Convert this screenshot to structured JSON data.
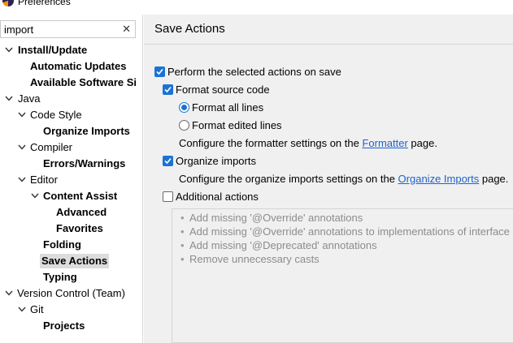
{
  "window": {
    "title": "Preferences"
  },
  "filter": {
    "value": "import",
    "clear_glyph": "✕"
  },
  "tree": [
    {
      "name": "tree-item-install-update",
      "label": "Install/Update",
      "bold": true,
      "twisty": "open"
    },
    {
      "name": "tree-item-automatic-updates",
      "label": "Automatic Updates",
      "bold": true,
      "twisty": "none"
    },
    {
      "name": "tree-item-available-software-sites",
      "label": "Available Software Si",
      "bold": true,
      "twisty": "none"
    },
    {
      "name": "tree-item-java",
      "label": "Java",
      "bold": false,
      "twisty": "open"
    },
    {
      "name": "tree-item-code-style",
      "label": "Code Style",
      "bold": false,
      "twisty": "open"
    },
    {
      "name": "tree-item-organize-imports",
      "label": "Organize Imports",
      "bold": true,
      "twisty": "none"
    },
    {
      "name": "tree-item-compiler",
      "label": "Compiler",
      "bold": false,
      "twisty": "open"
    },
    {
      "name": "tree-item-errors-warnings",
      "label": "Errors/Warnings",
      "bold": true,
      "twisty": "none"
    },
    {
      "name": "tree-item-editor",
      "label": "Editor",
      "bold": false,
      "twisty": "open"
    },
    {
      "name": "tree-item-content-assist",
      "label": "Content Assist",
      "bold": true,
      "twisty": "open"
    },
    {
      "name": "tree-item-advanced",
      "label": "Advanced",
      "bold": true,
      "twisty": "none"
    },
    {
      "name": "tree-item-favorites",
      "label": "Favorites",
      "bold": true,
      "twisty": "none"
    },
    {
      "name": "tree-item-folding",
      "label": "Folding",
      "bold": true,
      "twisty": "none"
    },
    {
      "name": "tree-item-save-actions",
      "label": "Save Actions",
      "bold": true,
      "twisty": "none",
      "selected": true
    },
    {
      "name": "tree-item-typing",
      "label": "Typing",
      "bold": true,
      "twisty": "none"
    },
    {
      "name": "tree-item-version-control",
      "label": "Version Control (Team)",
      "bold": false,
      "twisty": "open"
    },
    {
      "name": "tree-item-git",
      "label": "Git",
      "bold": false,
      "twisty": "open"
    },
    {
      "name": "tree-item-projects",
      "label": "Projects",
      "bold": true,
      "twisty": "none"
    }
  ],
  "page": {
    "title": "Save Actions",
    "perform_on_save": {
      "label": "Perform the selected actions on save",
      "checked": true
    },
    "format_source": {
      "label": "Format source code",
      "checked": true
    },
    "format_all": {
      "label": "Format all lines",
      "selected": true
    },
    "format_edited": {
      "label": "Format edited lines",
      "selected": false
    },
    "formatter_hint": {
      "before": "Configure the formatter settings on the ",
      "link": "Formatter",
      "after": " page."
    },
    "organize_imports": {
      "label": "Organize imports",
      "checked": true
    },
    "organize_hint": {
      "before": "Configure the organize imports settings on the ",
      "link": "Organize Imports",
      "after": " page."
    },
    "additional_actions": {
      "label": "Additional actions",
      "checked": false
    },
    "actions_list": [
      "Add missing '@Override' annotations",
      "Add missing '@Override' annotations to implementations of interface methods",
      "Add missing '@Deprecated' annotations",
      "Remove unnecessary casts"
    ],
    "bullet": "•"
  },
  "colors": {
    "accent": "#1a73d4",
    "link": "#1f62c8",
    "selection": "#dcdcdc",
    "disabled_text": "#8c8c8c"
  }
}
